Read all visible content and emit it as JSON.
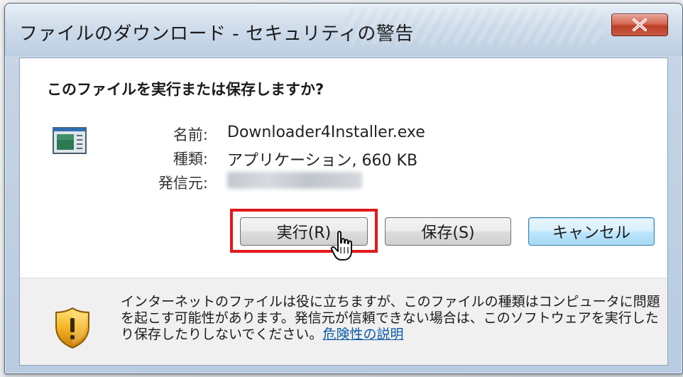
{
  "window": {
    "title": "ファイルのダウンロード - セキュリティの警告"
  },
  "dialog": {
    "question": "このファイルを実行または保存しますか?",
    "fields": {
      "name_label": "名前:",
      "name_value": "Downloader4Installer.exe",
      "type_label": "種類:",
      "type_value": "アプリケーション, 660 KB",
      "from_label": "発信元:"
    },
    "buttons": {
      "run": "実行(R)",
      "save": "保存(S)",
      "cancel": "キャンセル"
    },
    "warning": {
      "text": "インターネットのファイルは役に立ちますが、このファイルの種類はコンピュータに問題を起こす可能性があります。発信元が信頼できない場合は、このソフトウェアを実行したり保存したりしないでください。",
      "link": "危険性の説明"
    }
  },
  "annotations": {
    "highlight_color": "#e41818"
  },
  "icons": {
    "close": "close-icon",
    "file": "application-file-icon",
    "shield": "security-shield-icon",
    "cursor": "hand-pointer-cursor-icon"
  }
}
